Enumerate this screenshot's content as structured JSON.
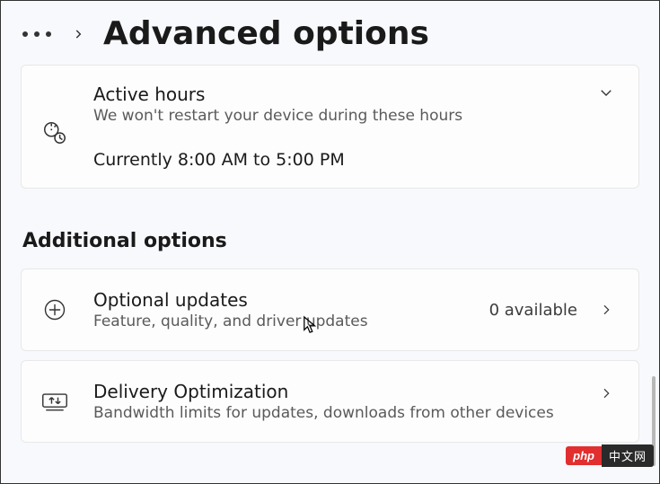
{
  "header": {
    "title": "Advanced options"
  },
  "cards": {
    "active_hours": {
      "title": "Active hours",
      "subtitle": "We won't restart your device during these hours",
      "current": "Currently 8:00 AM to 5:00 PM"
    },
    "optional_updates": {
      "title": "Optional updates",
      "subtitle": "Feature, quality, and driver updates",
      "count_label": "0 available"
    },
    "delivery_optimization": {
      "title": "Delivery Optimization",
      "subtitle": "Bandwidth limits for updates, downloads from other devices"
    }
  },
  "section_heading": "Additional options",
  "badge": {
    "left": "php",
    "right": "中文网"
  }
}
